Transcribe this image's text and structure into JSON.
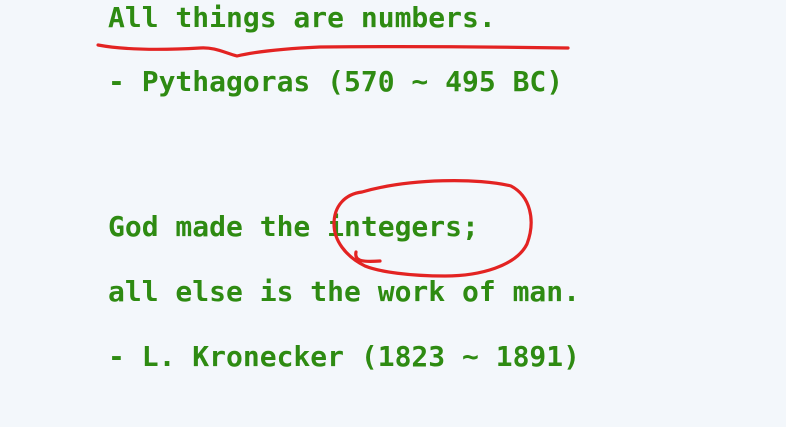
{
  "quote1": {
    "text": "All things are numbers.",
    "attribution": "- Pythagoras (570 ~ 495 BC)"
  },
  "quote2": {
    "line1": "God made the integers;",
    "line2": "all else is the work of man.",
    "attribution": "- L. Kronecker (1823 ~ 1891)"
  },
  "colors": {
    "text": "#2e8b12",
    "annotation": "#e32322",
    "background": "#f3f7fb"
  }
}
